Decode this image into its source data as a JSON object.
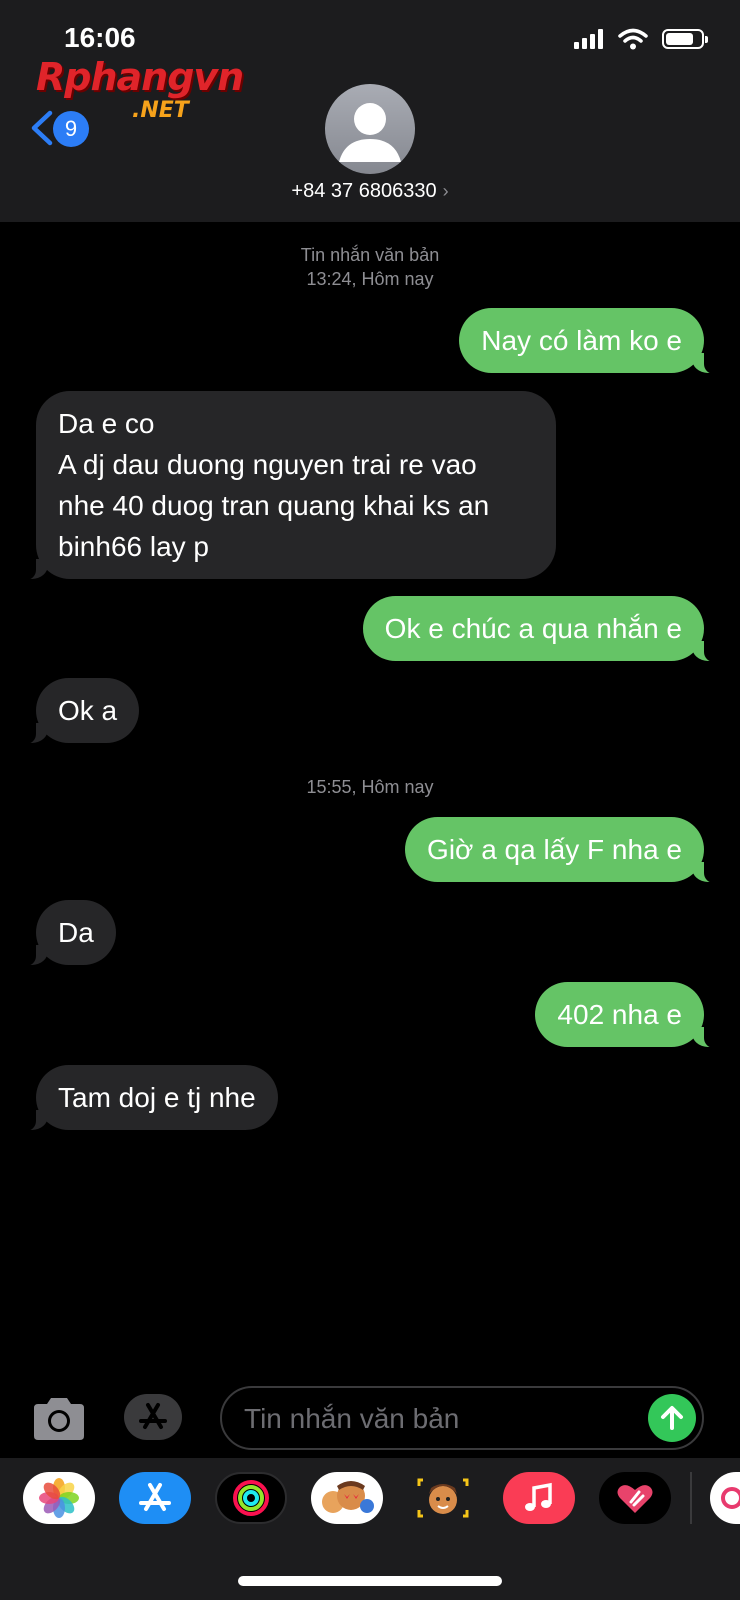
{
  "status_bar": {
    "time": "16:06"
  },
  "watermark": {
    "main": "Rphangvn",
    "sub": ".NET"
  },
  "header": {
    "back_count": "9",
    "contact": "+84 37 6806330",
    "contact_chevron": "›"
  },
  "conversation": {
    "intro_label": "Tin nhắn văn bản",
    "intro_time": "13:24, Hôm nay",
    "second_time": "15:55, Hôm nay",
    "messages": [
      {
        "direction": "outgoing",
        "text": "Nay có làm ko e"
      },
      {
        "direction": "incoming",
        "lines": [
          "Da e co",
          "A dj dau duong nguyen trai re vao",
          "nhe 40 duog tran quang khai ks an",
          "binh66 lay p"
        ]
      },
      {
        "direction": "outgoing",
        "text": "Ok e chúc a qua nhắn e"
      },
      {
        "direction": "incoming",
        "text": "Ok a"
      },
      {
        "direction": "outgoing",
        "text": "Giờ a qa lấy F nha e"
      },
      {
        "direction": "incoming",
        "text": "Da"
      },
      {
        "direction": "outgoing",
        "text": "402 nha e"
      },
      {
        "direction": "incoming",
        "text": "Tam doj e tj nhe"
      }
    ]
  },
  "compose": {
    "placeholder": "Tin nhắn văn bản",
    "value": ""
  },
  "drawer": {
    "apps": [
      "photos-icon",
      "app-store-icon",
      "activity-icon",
      "memoji-stickers-icon",
      "memoji-icon",
      "music-icon",
      "digital-touch-icon",
      "more-apps-icon"
    ]
  },
  "colors": {
    "outgoing": "#65c466",
    "incoming": "#262628",
    "badge": "#2c7df6",
    "send": "#33c759"
  }
}
